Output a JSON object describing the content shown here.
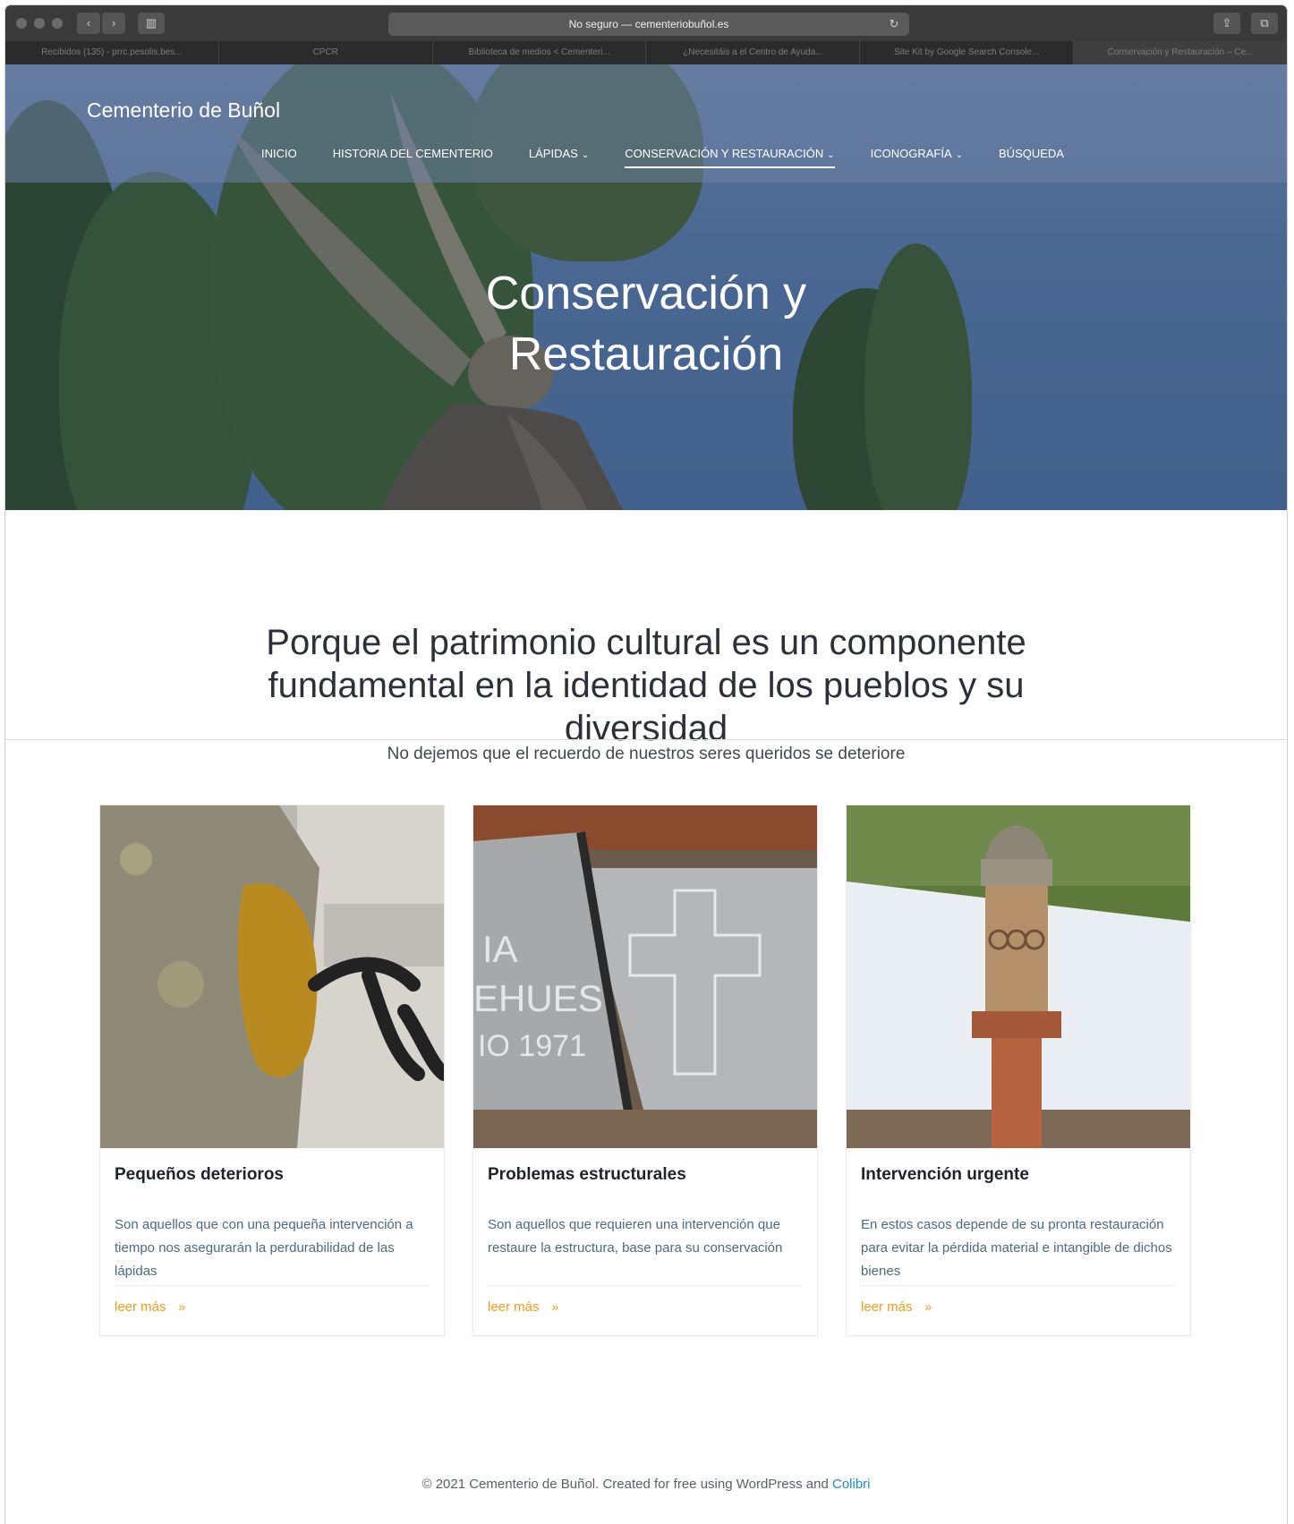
{
  "browser": {
    "address": "No seguro — cementeriobuñol.es",
    "tabs": [
      "Recibidos (135) - prrc.pesolis.bes...",
      "CPCR",
      "Biblioteca de medios < Cementeri...",
      "¿Necesitáis a el Centro de Ayuda...",
      "Site Kit by Google Search Console...",
      "Conservación y Restauración – Ce..."
    ]
  },
  "site": {
    "title": "Cementerio de Buñol"
  },
  "nav": {
    "items": [
      {
        "label": "INICIO",
        "dropdown": false,
        "active": false
      },
      {
        "label": "HISTORIA DEL CEMENTERIO",
        "dropdown": false,
        "active": false
      },
      {
        "label": "LÁPIDAS",
        "dropdown": true,
        "active": false
      },
      {
        "label": "CONSERVACIÓN Y RESTAURACIÓN",
        "dropdown": true,
        "active": true
      },
      {
        "label": "ICONOGRAFÍA",
        "dropdown": true,
        "active": false
      },
      {
        "label": "BÚSQUEDA",
        "dropdown": false,
        "active": false
      }
    ]
  },
  "hero": {
    "title_line1": "Conservación y",
    "title_line2": "Restauración"
  },
  "intro": {
    "title_line1": "Porque el patrimonio cultural es un componente",
    "title_line2": "fundamental en la identidad de los pueblos y su",
    "title_line3": "diversidad",
    "subtitle": "No dejemos que el recuerdo de nuestros seres queridos se deteriore"
  },
  "cards": [
    {
      "title": "Pequeños deterioros",
      "text": "Son aquellos que con una pequeña intervención a tiempo nos asegurarán la perdurabilidad de las lápidas",
      "link": "leer más"
    },
    {
      "title": "Problemas estructurales",
      "text": "Son aquellos que requieren una intervención que restaure la estructura, base para su conservación",
      "link": "leer más"
    },
    {
      "title": "Intervención urgente",
      "text": "En estos casos depende de su pronta restauración para evitar la pérdida material e intangible de dichos bienes",
      "link": "leer más"
    }
  ],
  "footer": {
    "text": "© 2021 Cementerio de Buñol. Created for free using WordPress and",
    "link": "Colibri"
  },
  "colors": {
    "accent_link": "#f39c12",
    "footer_link": "#1e88e5",
    "card_text": "#4c6a82"
  }
}
